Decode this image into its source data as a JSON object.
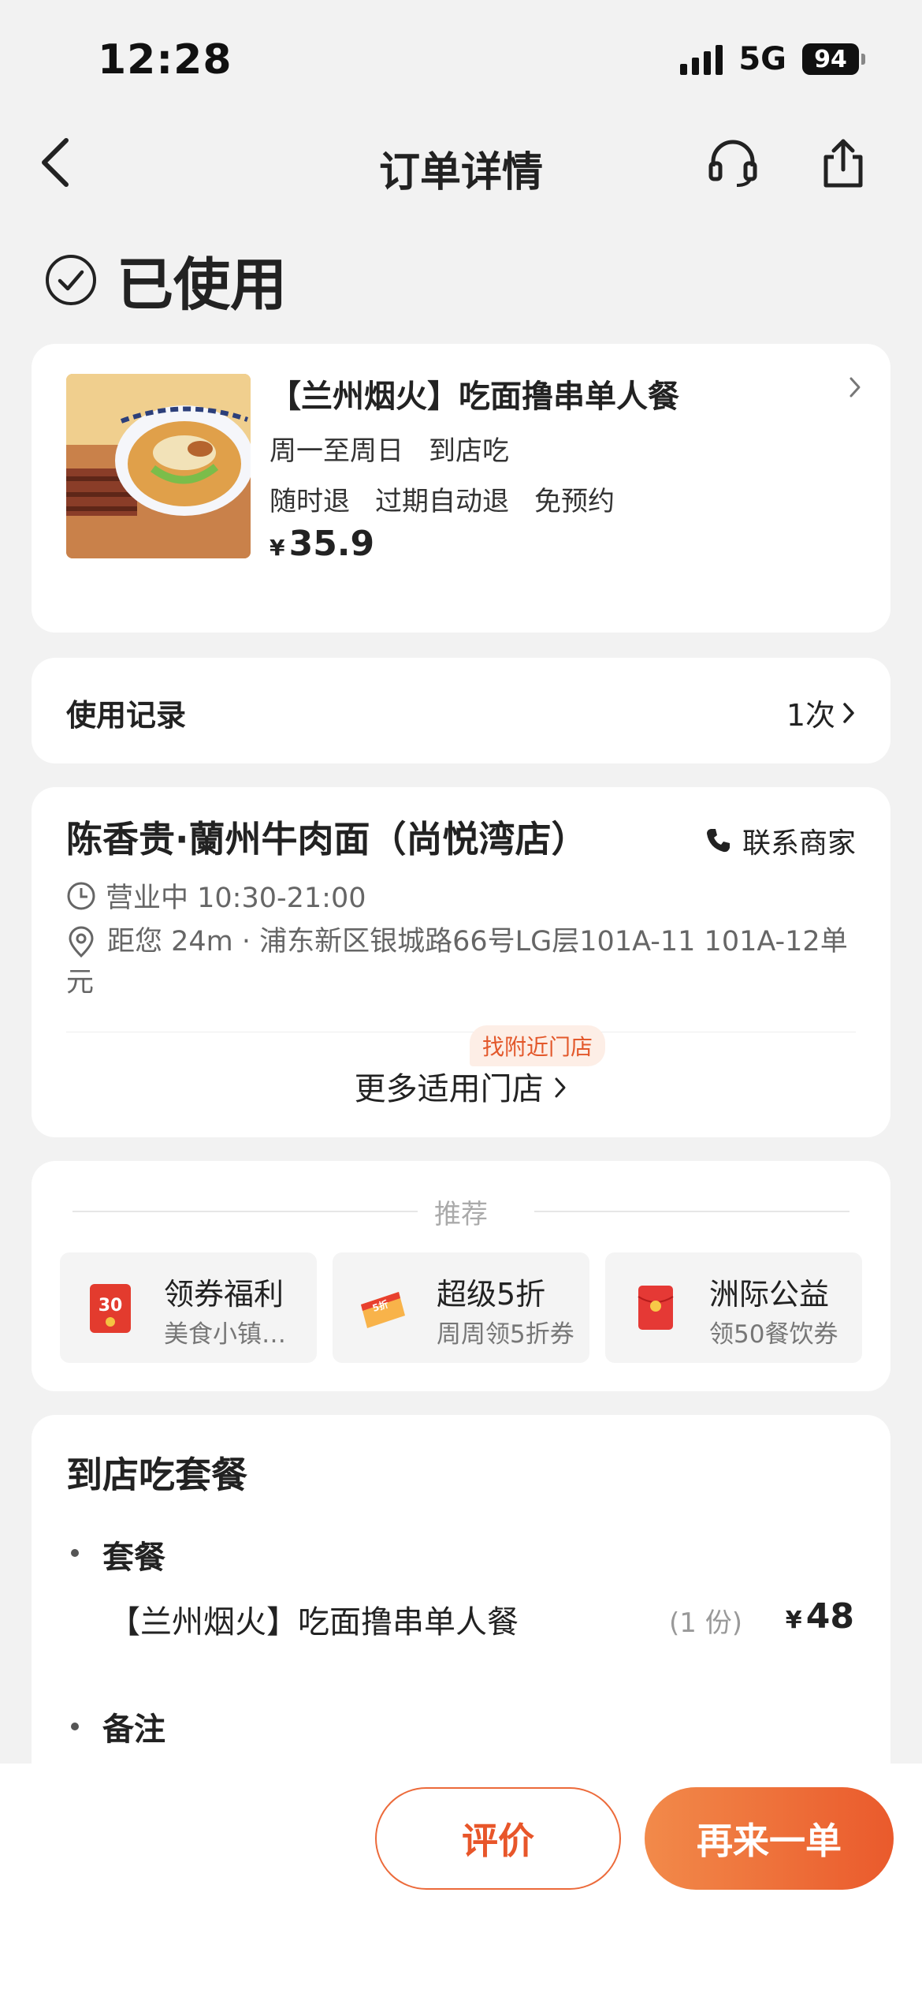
{
  "status_bar": {
    "time": "12:28",
    "network": "5G",
    "battery": "94"
  },
  "nav": {
    "title": "订单详情",
    "icons": [
      "back-icon",
      "headset-icon",
      "share-icon"
    ]
  },
  "order_status": {
    "label": "已使用",
    "icon": "check-circle-icon"
  },
  "product": {
    "title": "【兰州烟火】吃面撸串单人餐",
    "schedule": [
      "周一至周日",
      "到店吃"
    ],
    "policies": [
      "随时退",
      "过期自动退",
      "免预约"
    ],
    "currency": "¥",
    "price": "35.9"
  },
  "usage_record": {
    "label": "使用记录",
    "count": "1次"
  },
  "store": {
    "name": "陈香贵·蘭州牛肉面（尚悦湾店）",
    "contact_label": "联系商家",
    "hours": "营业中 10:30-21:00",
    "address": "距您 24m · 浦东新区银城路66号LG层101A-11 101A-12单元",
    "nearby_tag": "找附近门店",
    "more_stores": "更多适用门店"
  },
  "recommend": {
    "title": "推荐",
    "items": [
      {
        "title": "领券福利",
        "subtitle": "美食小镇…",
        "icon": "coupon-30-icon"
      },
      {
        "title": "超级5折",
        "subtitle": "周周领5折券",
        "icon": "discount-5-icon"
      },
      {
        "title": "洲际公益",
        "subtitle": "领50餐饮券",
        "icon": "red-envelope-icon"
      }
    ]
  },
  "package": {
    "title": "到店吃套餐",
    "section_label": "套餐",
    "item_name": "【兰州烟火】吃面撸串单人餐",
    "item_qty": "(1 份)",
    "currency": "¥",
    "item_price": "48",
    "note_label": "备注"
  },
  "actions": {
    "review": "评价",
    "reorder": "再来一单"
  },
  "colors": {
    "accent": "#ea5a2c",
    "background": "#f2f2f2"
  }
}
